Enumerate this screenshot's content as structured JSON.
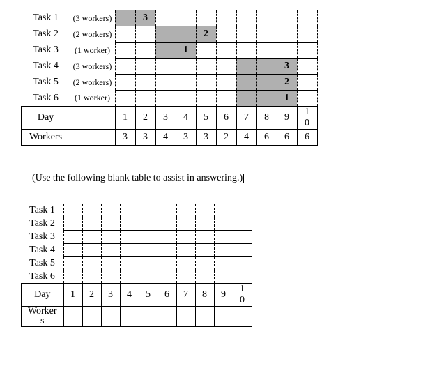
{
  "chart_data": {
    "type": "bar",
    "title": "",
    "tasks": [
      {
        "name": "Task 1",
        "capacity": "(3 workers)",
        "start": 1,
        "end": 2,
        "label_day": 2,
        "label": "3"
      },
      {
        "name": "Task 2",
        "capacity": "(2 workers)",
        "start": 3,
        "end": 5,
        "label_day": 5,
        "label": "2"
      },
      {
        "name": "Task 3",
        "capacity": "(1 worker)",
        "start": 3,
        "end": 4,
        "label_day": 4,
        "label": "1"
      },
      {
        "name": "Task 4",
        "capacity": "(3 workers)",
        "start": 7,
        "end": 9,
        "label_day": 9,
        "label": "3"
      },
      {
        "name": "Task 5",
        "capacity": "(2 workers)",
        "start": 7,
        "end": 9,
        "label_day": 9,
        "label": "2"
      },
      {
        "name": "Task 6",
        "capacity": "(1 worker)",
        "start": 7,
        "end": 9,
        "label_day": 9,
        "label": "1"
      }
    ],
    "days": [
      "1",
      "2",
      "3",
      "4",
      "5",
      "6",
      "7",
      "8",
      "9",
      "10"
    ],
    "workers": [
      "3",
      "3",
      "4",
      "3",
      "3",
      "2",
      "4",
      "6",
      "6",
      "6"
    ],
    "row_headers": {
      "day": "Day",
      "workers": "Workers"
    }
  },
  "hint_text": "(Use the following blank table to assist in answering.)",
  "blank_table": {
    "tasks": [
      "Task 1",
      "Task 2",
      "Task 3",
      "Task 4",
      "Task 5",
      "Task 6"
    ],
    "days": [
      "1",
      "2",
      "3",
      "4",
      "5",
      "6",
      "7",
      "8",
      "9",
      "10"
    ],
    "row_headers": {
      "day": "Day",
      "workers": "Workers"
    }
  }
}
